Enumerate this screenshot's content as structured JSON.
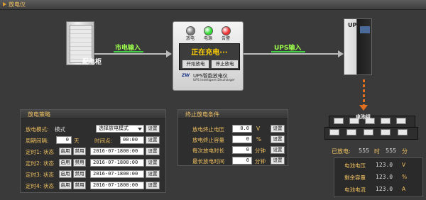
{
  "window": {
    "title": "放电仪"
  },
  "diagram": {
    "cabinet_label": "配电柜",
    "mains_input_label": "市电输入",
    "ups_input_label": "UPS输入",
    "ups_label": "UPS",
    "battery_label": "电池组",
    "device": {
      "lamps": [
        {
          "label": "放电",
          "color": "#7a7a7a"
        },
        {
          "label": "电源",
          "color": "#33dd33"
        },
        {
          "label": "告警",
          "color": "#ee3333"
        }
      ],
      "status_text": "正在充电···",
      "start_button": "开始放电",
      "stop_button": "停止放电",
      "logo": "ZW",
      "name": "UPS智能放电仪",
      "subtitle": "UPS Intelligent Discharger"
    }
  },
  "strategy": {
    "title": "放电策略",
    "mode_label": "放电模式:",
    "mode_value": "模式",
    "mode_select": "选择放电模式",
    "set_label": "设置",
    "cycle_label": "周期间隔:",
    "cycle_value": "0",
    "cycle_unit": "天",
    "time_label": "时间点:",
    "time_value": "00:00",
    "timers": [
      {
        "label": "定时1:",
        "status_label": "状态",
        "enable": "启用",
        "disable": "禁用",
        "value": "2016-07-1800:00"
      },
      {
        "label": "定时2:",
        "status_label": "状态",
        "enable": "启用",
        "disable": "禁用",
        "value": "2016-07-1800:00"
      },
      {
        "label": "定时3:",
        "status_label": "状态",
        "enable": "启用",
        "disable": "禁用",
        "value": "2016-07-1800:00"
      },
      {
        "label": "定时4:",
        "status_label": "状态",
        "enable": "启用",
        "disable": "禁用",
        "value": "2016-07-1800:00"
      }
    ]
  },
  "stop_conditions": {
    "title": "终止放电条件",
    "set_label": "设置",
    "rows": [
      {
        "label": "放电终止电压",
        "value": "0.0",
        "unit": "V"
      },
      {
        "label": "放电终止容量",
        "value": "0",
        "unit": "%"
      },
      {
        "label": "每次放电时长",
        "value": "0",
        "unit": "分钟"
      },
      {
        "label": "最长放电时间",
        "value": "0",
        "unit": "分钟"
      }
    ]
  },
  "status": {
    "discharged_label": "已放电:",
    "discharged_value": "555",
    "discharged_mid": "时",
    "discharged_value2": "555",
    "discharged_unit": "分",
    "readings": [
      {
        "label": "电池电压",
        "value": "123.0",
        "unit": "V"
      },
      {
        "label": "剩余容量",
        "value": "123.0",
        "unit": "%"
      },
      {
        "label": "电池电流",
        "value": "123.0",
        "unit": "A"
      }
    ]
  },
  "colors": {
    "accent": "#f0c060",
    "flow_label": "#9cff4a",
    "status_text": "#ffd000",
    "connector": "#e07020"
  }
}
